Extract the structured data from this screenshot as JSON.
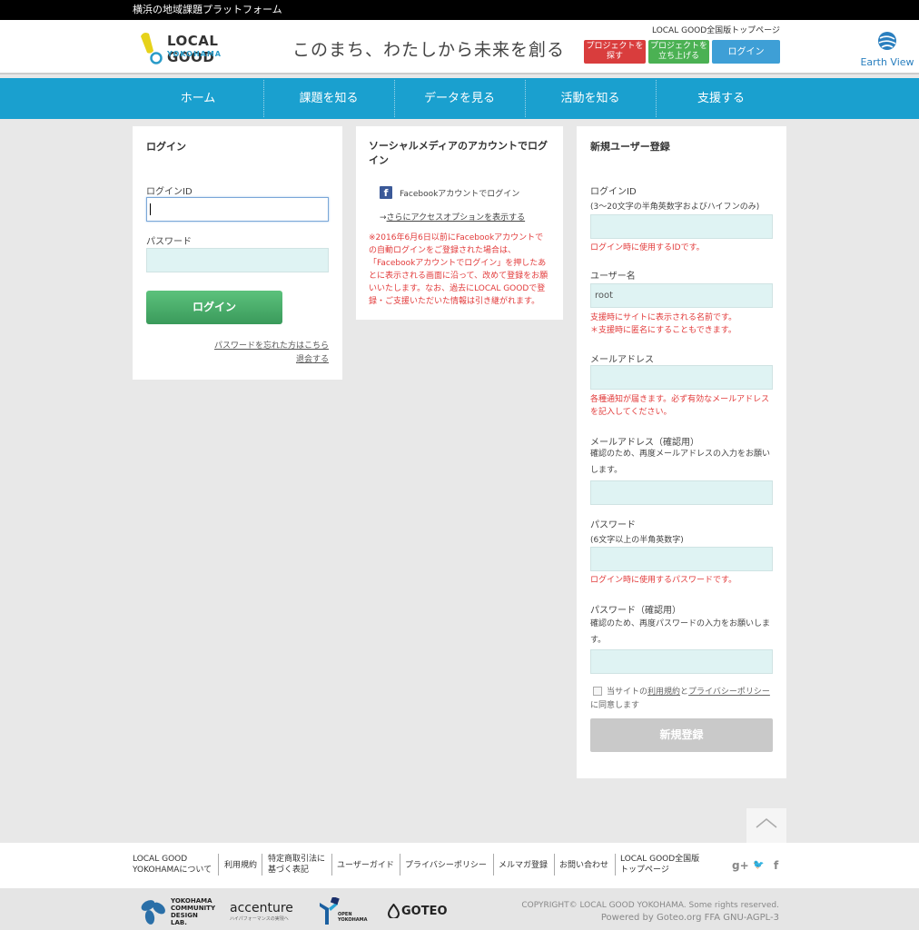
{
  "topbar": {
    "text": "横浜の地域課題プラットフォーム"
  },
  "header": {
    "logo_main": "LOCAL GOOD",
    "logo_sub": "YOKOHAMA",
    "tagline": "このまち、わたしから未来を創る",
    "national_link": "LOCAL GOOD全国版トップページ",
    "btn_find_l1": "プロジェクトを",
    "btn_find_l2": "探す",
    "btn_start_l1": "プロジェクトを",
    "btn_start_l2": "立ち上げる",
    "btn_login": "ログイン",
    "earth_view": "Earth View"
  },
  "nav": {
    "items": [
      "ホーム",
      "課題を知る",
      "データを見る",
      "活動を知る",
      "支援する"
    ]
  },
  "login": {
    "title": "ログイン",
    "id_label": "ログインID",
    "pw_label": "パスワード",
    "button": "ログイン",
    "forgot": "パスワードを忘れた方はこちら",
    "withdraw": "退会する"
  },
  "social": {
    "title_l1": "ソーシャルメディアのアカウントでログ",
    "title_l2": "イン",
    "facebook": "Facebookアカウントでログイン",
    "arrow": "→",
    "more": "さらにアクセスオプションを表示する",
    "note": [
      "※2016年6月6日以前にFacebookアカウントで",
      "の自動ログインをご登録された場合は、",
      "「Facebookアカウントでログイン」を押したあ",
      "とに表示される画面に沿って、改めて登録をお願",
      "いいたします。なお、過去にLOCAL GOODで登",
      "録・ご支援いただいた情報は引き継がれます。"
    ]
  },
  "register": {
    "title": "新規ユーザー登録",
    "id_label": "ログインID",
    "id_hint": "(3〜20文字の半角英数字およびハイフンのみ)",
    "id_note": "ログイン時に使用するIDです。",
    "name_label": "ユーザー名",
    "name_value": "root",
    "name_note_1": "支援時にサイトに表示される名前です。",
    "name_note_2": "＊支援時に匿名にすることもできます。",
    "email_label": "メールアドレス",
    "email_note_1": "各種通知が届きます。必ず有効なメールアドレス",
    "email_note_2": "を記入してください。",
    "email2_label": "メールアドレス（確認用）",
    "email2_hint_1": "確認のため、再度メールアドレスの入力をお願い",
    "email2_hint_2": "します。",
    "pw_label": "パスワード",
    "pw_hint": "(6文字以上の半角英数字)",
    "pw_note": "ログイン時に使用するパスワードです。",
    "pw2_label": "パスワード（確認用）",
    "pw2_hint_1": "確認のため、再度パスワードの入力をお願いしま",
    "pw2_hint_2": "す。",
    "agree_prefix": "当サイトの",
    "terms": "利用規約",
    "and": "と",
    "privacy": "プライバシーポリシー",
    "agree_suffix": "に同意します",
    "button": "新規登録"
  },
  "footer": {
    "about_l1": "LOCAL GOOD",
    "about_l2": "YOKOHAMAについて",
    "terms": "利用規約",
    "tokusho_l1": "特定商取引法に",
    "tokusho_l2": "基づく表記",
    "guide": "ユーザーガイド",
    "privacy": "プライバシーポリシー",
    "mailmag": "メルマガ登録",
    "contact": "お問い合わせ",
    "national_l1": "LOCAL GOOD全国版",
    "national_l2": "トップページ",
    "gplus": "g+",
    "twitter": "🐦",
    "facebook": "f"
  },
  "sponsors": {
    "ycd_1": "YOKOHAMA",
    "ycd_2": "COMMUNITY",
    "ycd_3": "DESIGN",
    "ycd_4": "LAB.",
    "accenture": "accenture",
    "accenture_sub": "ハイパフォーマンスの実現へ",
    "oy_1": "OPEN",
    "oy_2": "YOKOHAMA",
    "goteo": "GOTEO"
  },
  "copyright": {
    "line1": "COPYRIGHT© LOCAL GOOD YOKOHAMA. Some rights reserved.",
    "line2": "Powered by Goteo.org FFA GNU-AGPL-3"
  }
}
